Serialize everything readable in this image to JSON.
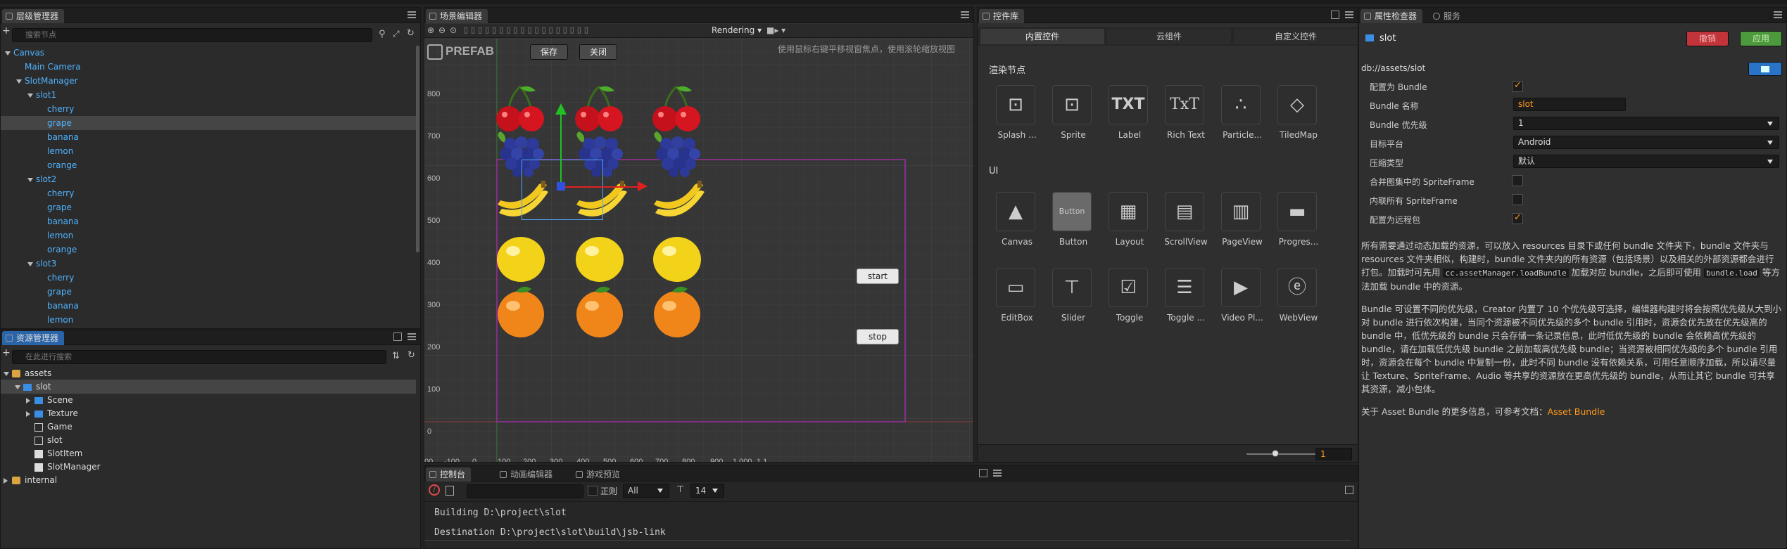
{
  "hierarchy": {
    "title": "层级管理器",
    "search_placeholder": "搜索节点",
    "nodes": [
      {
        "label": "Canvas",
        "depth": 0,
        "arrow": "down"
      },
      {
        "label": "Main Camera",
        "depth": 1,
        "arrow": "none"
      },
      {
        "label": "SlotManager",
        "depth": 1,
        "arrow": "down"
      },
      {
        "label": "slot1",
        "depth": 2,
        "arrow": "down"
      },
      {
        "label": "cherry",
        "depth": 3,
        "arrow": "none"
      },
      {
        "label": "grape",
        "depth": 3,
        "arrow": "none",
        "selected": true
      },
      {
        "label": "banana",
        "depth": 3,
        "arrow": "none"
      },
      {
        "label": "lemon",
        "depth": 3,
        "arrow": "none"
      },
      {
        "label": "orange",
        "depth": 3,
        "arrow": "none"
      },
      {
        "label": "slot2",
        "depth": 2,
        "arrow": "down"
      },
      {
        "label": "cherry",
        "depth": 3,
        "arrow": "none"
      },
      {
        "label": "grape",
        "depth": 3,
        "arrow": "none"
      },
      {
        "label": "banana",
        "depth": 3,
        "arrow": "none"
      },
      {
        "label": "lemon",
        "depth": 3,
        "arrow": "none"
      },
      {
        "label": "orange",
        "depth": 3,
        "arrow": "none"
      },
      {
        "label": "slot3",
        "depth": 2,
        "arrow": "down"
      },
      {
        "label": "cherry",
        "depth": 3,
        "arrow": "none"
      },
      {
        "label": "grape",
        "depth": 3,
        "arrow": "none"
      },
      {
        "label": "banana",
        "depth": 3,
        "arrow": "none"
      },
      {
        "label": "lemon",
        "depth": 3,
        "arrow": "none"
      }
    ]
  },
  "assets": {
    "title": "资源管理器",
    "search_placeholder": "在此进行搜索",
    "items": [
      {
        "label": "assets",
        "depth": 0,
        "icon": "db",
        "arrow": "down"
      },
      {
        "label": "slot",
        "depth": 1,
        "icon": "folder",
        "arrow": "down",
        "selected": true
      },
      {
        "label": "Scene",
        "depth": 2,
        "icon": "folder",
        "arrow": "right"
      },
      {
        "label": "Texture",
        "depth": 2,
        "icon": "folder",
        "arrow": "right"
      },
      {
        "label": "Game",
        "depth": 2,
        "icon": "scene",
        "arrow": "none"
      },
      {
        "label": "slot",
        "depth": 2,
        "icon": "scene",
        "arrow": "none"
      },
      {
        "label": "SlotItem",
        "depth": 2,
        "icon": "ts",
        "arrow": "none"
      },
      {
        "label": "SlotManager",
        "depth": 2,
        "icon": "ts",
        "arrow": "none"
      },
      {
        "label": "internal",
        "depth": 0,
        "icon": "db",
        "arrow": "right"
      }
    ]
  },
  "scene": {
    "title": "场景编辑器",
    "rendering": "Rendering",
    "prefab": "PREFAB",
    "save": "保存",
    "close": "关闭",
    "hint": "使用鼠标右键平移视窗焦点，使用滚轮缩放视图",
    "start": "start",
    "stop": "stop",
    "y_ticks": [
      "800",
      "700",
      "600",
      "500",
      "400",
      "300",
      "200",
      "100",
      "0"
    ],
    "x_ticks": [
      "00",
      "-100",
      "0",
      "100",
      "200",
      "300",
      "400",
      "500",
      "600",
      "700",
      "800",
      "900",
      "1,000",
      "1,1"
    ]
  },
  "widgets": {
    "title": "控件库",
    "tabs": [
      "内置控件",
      "云组件",
      "自定义控件"
    ],
    "section_render": "渲染节点",
    "section_ui": "UI",
    "render_items": [
      "Splash ...",
      "Sprite",
      "Label",
      "Rich Text",
      "Particle...",
      "TiledMap"
    ],
    "ui_row1": [
      "Canvas",
      "Button",
      "Layout",
      "ScrollView",
      "PageView",
      "Progres..."
    ],
    "ui_row2": [
      "EditBox",
      "Slider",
      "Toggle",
      "Toggle ...",
      "Video Pl...",
      "WebView"
    ],
    "button_glyph": "Button",
    "txt1": "TXT",
    "txt2": "TxT",
    "zoom_value": "1"
  },
  "inspector": {
    "title": "属性检查器",
    "tab2": "服务",
    "revert": "撤销",
    "apply": "应用",
    "name": "slot",
    "path": "db://assets/slot",
    "props": {
      "bundle_flag": "配置为 Bundle",
      "bundle_name_label": "Bundle 名称",
      "bundle_name_value": "slot",
      "priority_label": "Bundle 优先级",
      "priority_value": "1",
      "platform_label": "目标平台",
      "platform_value": "Android",
      "compress_label": "压缩类型",
      "compress_value": "默认",
      "merge_label": "合并图集中的 SpriteFrame",
      "inline_label": "内联所有 SpriteFrame",
      "remote_label": "配置为远程包"
    },
    "para1_a": "所有需要通过动态加载的资源，可以放入 resources 目录下或任何 bundle 文件夹下，bundle 文件夹与 resources 文件夹相似，构建时，bundle 文件夹内的所有资源（包括场景）以及相关的外部资源都会进行打包。加载时可先用 ",
    "para1_code1": "cc.assetManager.loadBundle",
    "para1_b": " 加载对应 bundle，之后即可使用 ",
    "para1_code2": "bundle.load",
    "para1_c": " 等方法加载 bundle 中的资源。",
    "para2": "Bundle 可设置不同的优先级，Creator 内置了 10 个优先级可选择，编辑器构建时将会按照优先级从大到小对 bundle 进行依次构建，当同个资源被不同优先级的多个 bundle 引用时，资源会优先放在优先级高的 bundle 中，低优先级的 bundle 只会存储一条记录信息，此时低优先级的 bundle 会依赖高优先级的 bundle，请在加载低优先级 bundle 之前加载高优先级 bundle；当资源被相同优先级的多个 bundle 引用时，资源会在每个 bundle 中复制一份，此时不同 bundle 没有依赖关系，可用任意顺序加载，所以请尽量让 Texture、SpriteFrame、Audio 等共享的资源放在更高优先级的 bundle，从而让其它 bundle 可共享其资源，减小包体。",
    "para3": "关于 Asset Bundle 的更多信息，可参考文档：",
    "para3_link": "Asset Bundle"
  },
  "console": {
    "tabs": [
      "控制台",
      "动画编辑器",
      "游戏预览"
    ],
    "regex": "正则",
    "filter": "All",
    "font_size": "14",
    "lines": [
      "Building D:\\project\\slot",
      "Destination D:\\project\\slot\\build\\jsb-link"
    ]
  },
  "colors": {
    "accent_blue": "#4fb3ff",
    "orange": "#ff9a1a",
    "revert": "#c0343a",
    "apply": "#4d9a3d"
  }
}
